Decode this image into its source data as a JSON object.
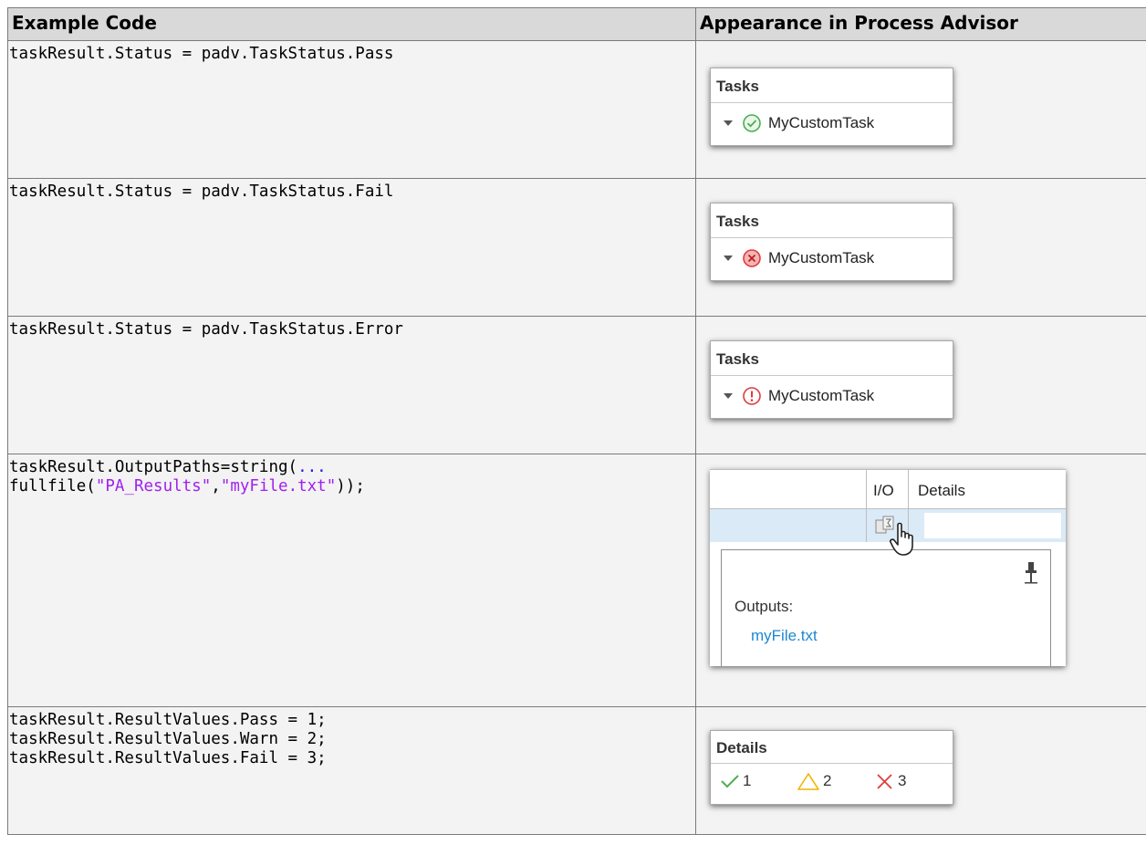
{
  "table": {
    "headers": [
      "Example Code",
      "Appearance in Process Advisor"
    ]
  },
  "rows": [
    {
      "code": {
        "text": "taskResult.Status = padv.TaskStatus.Pass"
      },
      "tasks_panel": {
        "header": "Tasks",
        "task_name": "MyCustomTask",
        "status_icon": "pass-check-circle-icon"
      }
    },
    {
      "code": {
        "text": "taskResult.Status = padv.TaskStatus.Fail"
      },
      "tasks_panel": {
        "header": "Tasks",
        "task_name": "MyCustomTask",
        "status_icon": "fail-x-circle-icon"
      }
    },
    {
      "code": {
        "text": "taskResult.Status = padv.TaskStatus.Error"
      },
      "tasks_panel": {
        "header": "Tasks",
        "task_name": "MyCustomTask",
        "status_icon": "error-exclamation-circle-icon"
      }
    },
    {
      "code": {
        "line1_a": "taskResult.OutputPaths=string(",
        "line1_b": "...",
        "line2_a": "fullfile(",
        "line2_b": "\"PA_Results\"",
        "line2_c": ",",
        "line2_d": "\"myFile.txt\"",
        "line2_e": "));"
      },
      "io_panel": {
        "col_io": "I/O",
        "col_details": "Details",
        "outputs_label": "Outputs:",
        "output_link": "myFile.txt"
      }
    },
    {
      "code": {
        "line1": "taskResult.ResultValues.Pass = 1;",
        "line2": "taskResult.ResultValues.Warn = 2;",
        "line3": "taskResult.ResultValues.Fail = 3;"
      },
      "details_panel": {
        "header": "Details",
        "pass_count": "1",
        "warn_count": "2",
        "fail_count": "3"
      }
    }
  ],
  "colors": {
    "pass": "#4caf50",
    "fail": "#e03c3c",
    "warn": "#f0b400",
    "link": "#1e88d2",
    "code_keyword": "#1a1aff",
    "code_string": "#a020f0"
  }
}
